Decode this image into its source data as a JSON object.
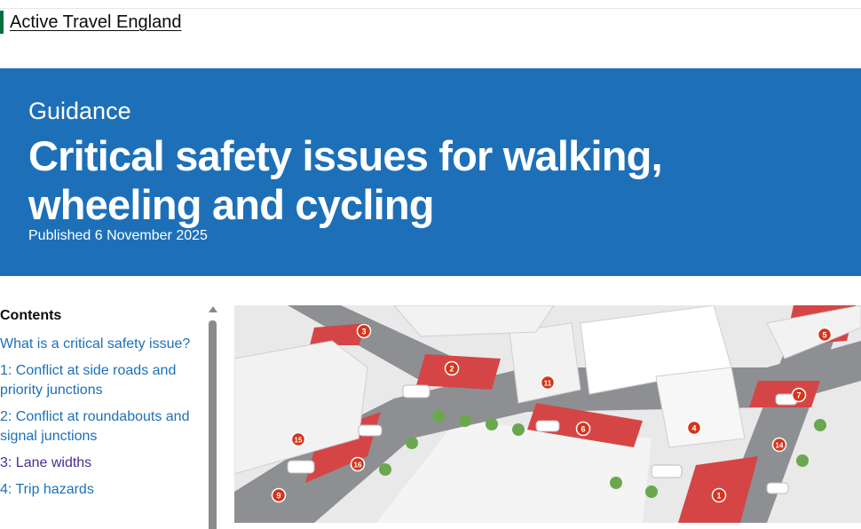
{
  "header": {
    "organisation": "Active Travel England"
  },
  "hero": {
    "caption": "Guidance",
    "title": "Critical safety issues for walking, wheeling and cycling",
    "published": "Published 6 November 2025"
  },
  "contents": {
    "heading": "Contents",
    "items": [
      {
        "label": "What is a critical safety issue?",
        "visited": false
      },
      {
        "label": "1: Conflict at side roads and priority junctions",
        "visited": false
      },
      {
        "label": "2: Conflict at roundabouts and signal junctions",
        "visited": false
      },
      {
        "label": "3: Lane widths",
        "visited": true
      },
      {
        "label": "4: Trip hazards",
        "visited": false
      }
    ]
  },
  "illustration": {
    "markers": [
      "1",
      "2",
      "3",
      "4",
      "5",
      "6",
      "7",
      "9",
      "11",
      "14",
      "15",
      "16"
    ],
    "colors": {
      "road": "#8d8f93",
      "hazard_zone": "#d64545",
      "pavement": "#e9e9ea",
      "building": "#f2f2f2",
      "marker": "#d4351c"
    }
  },
  "colors": {
    "hero_background": "#1d70b8",
    "link": "#1d70b8",
    "visited_link": "#4c2c92",
    "organisation_bar": "#00703c"
  }
}
